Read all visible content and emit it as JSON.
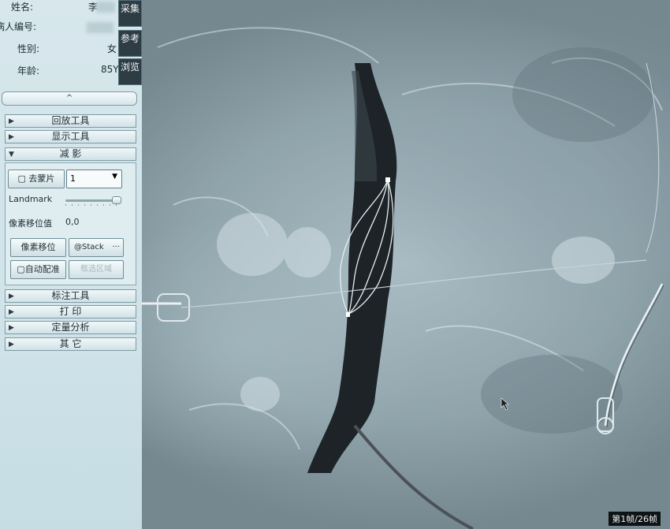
{
  "patient": {
    "name_label": "姓名:",
    "name_value": "李",
    "id_label": "病人编号:",
    "gender_label": "性别:",
    "gender_value": "女",
    "age_label": "年龄:",
    "age_value": "85Y"
  },
  "side_tabs": [
    "采集",
    "参考",
    "浏览"
  ],
  "collapse_symbol": "^",
  "sections": {
    "playback": "回放工具",
    "display": "显示工具",
    "subtraction": "减 影",
    "annotation": "标注工具",
    "print": "打 印",
    "quant": "定量分析",
    "other": "其 它"
  },
  "subtraction_panel": {
    "mask_button": "▢ 去蒙片",
    "mask_select_value": "1",
    "landmark_label": "Landmark",
    "landmark_level": 0.95,
    "pixel_shift_label": "像素移位值",
    "pixel_shift_value": "0,0",
    "pixel_shift_button": "像素移位",
    "stack_button": "Stack",
    "stack_more": "···",
    "auto_register_button": "▢自动配准",
    "select_region_button": "框选区域"
  },
  "viewer": {
    "frame_counter": "第1帧/26帧"
  },
  "icons": {
    "cursor": "arrow-cursor-icon",
    "expand": "triangle-right-icon",
    "dropdown": "chevron-down-icon"
  },
  "colors": {
    "panel_bg": "#d3e6eb",
    "tab_bg": "#2e3d44",
    "vessel": "#1b2024"
  }
}
